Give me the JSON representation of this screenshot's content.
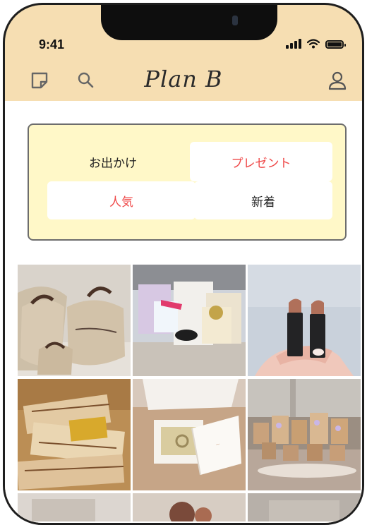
{
  "status_bar": {
    "time": "9:41"
  },
  "header": {
    "brand": "Plan B"
  },
  "category_tabs": [
    {
      "label": "お出かけ",
      "selected": false
    },
    {
      "label": "プレゼント",
      "selected": true
    }
  ],
  "sort_tabs": [
    {
      "label": "人気",
      "selected": true
    },
    {
      "label": "新着",
      "selected": false
    }
  ],
  "icons": {
    "note": "note-icon",
    "search": "search-icon",
    "profile": "profile-icon"
  },
  "gallery": [
    {
      "name": "gift-bags-photo"
    },
    {
      "name": "gift-boxes-photo"
    },
    {
      "name": "lipsticks-photo"
    },
    {
      "name": "wrapped-gifts-photo"
    },
    {
      "name": "jewelry-box-photo"
    },
    {
      "name": "gift-table-photo"
    }
  ],
  "colors": {
    "header_bg": "#f6deb2",
    "selector_bg": "#fff8c8",
    "accent_red": "#ef4a4a"
  }
}
